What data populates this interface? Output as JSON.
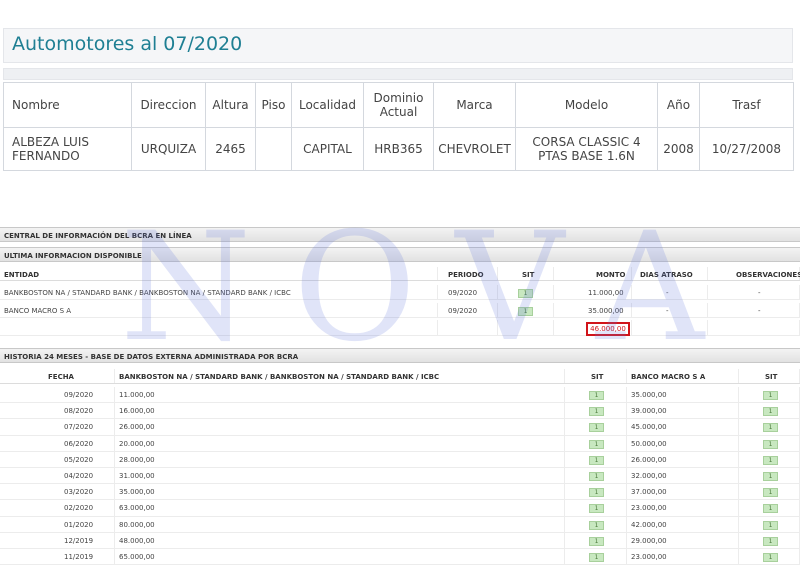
{
  "automotores": {
    "title": "Automotores al 07/2020",
    "columns": [
      "Nombre",
      "Direccion",
      "Altura",
      "Piso",
      "Localidad",
      "Dominio Actual",
      "Marca",
      "Modelo",
      "Año",
      "Trasf"
    ],
    "row": [
      "ALBEZA LUIS FERNANDO",
      "URQUIZA",
      "2465",
      "",
      "CAPITAL",
      "HRB365",
      "CHEVROLET",
      "CORSA CLASSIC 4 PTAS BASE 1.6N",
      "2008",
      "10/27/2008"
    ]
  },
  "bcra": {
    "header": "CENTRAL DE INFORMACIÓN DEL BCRA EN LÍNEA",
    "ultima_title": "ULTIMA INFORMACION DISPONIBLE",
    "ultima_columns": [
      "ENTIDAD",
      "PERIODO",
      "SIT",
      "MONTO",
      "DIAS ATRASO",
      "OBSERVACIONES"
    ],
    "ultima_rows": [
      {
        "entidad": "BANKBOSTON NA / STANDARD BANK / BANKBOSTON NA / STANDARD BANK / ICBC",
        "periodo": "09/2020",
        "sit": "1",
        "monto": "11.000,00",
        "dias": "-",
        "obs": "-"
      },
      {
        "entidad": "BANCO MACRO S A",
        "periodo": "09/2020",
        "sit": "1",
        "monto": "35.000,00",
        "dias": "-",
        "obs": "-"
      }
    ],
    "total": "46.000,00",
    "historia_title": "HISTORIA 24 MESES - BASE DE DATOS EXTERNA ADMINISTRADA POR BCRA",
    "historia_columns": [
      "FECHA",
      "BANKBOSTON NA / STANDARD BANK / BANKBOSTON NA / STANDARD BANK / ICBC",
      "SIT",
      "BANCO MACRO S A",
      "SIT"
    ],
    "historia_rows": [
      {
        "fecha": "09/2020",
        "monto1": "11.000,00",
        "sit1": "1",
        "monto2": "35.000,00",
        "sit2": "1"
      },
      {
        "fecha": "08/2020",
        "monto1": "16.000,00",
        "sit1": "1",
        "monto2": "39.000,00",
        "sit2": "1"
      },
      {
        "fecha": "07/2020",
        "monto1": "26.000,00",
        "sit1": "1",
        "monto2": "45.000,00",
        "sit2": "1"
      },
      {
        "fecha": "06/2020",
        "monto1": "20.000,00",
        "sit1": "1",
        "monto2": "50.000,00",
        "sit2": "1"
      },
      {
        "fecha": "05/2020",
        "monto1": "28.000,00",
        "sit1": "1",
        "monto2": "26.000,00",
        "sit2": "1"
      },
      {
        "fecha": "04/2020",
        "monto1": "31.000,00",
        "sit1": "1",
        "monto2": "32.000,00",
        "sit2": "1"
      },
      {
        "fecha": "03/2020",
        "monto1": "35.000,00",
        "sit1": "1",
        "monto2": "37.000,00",
        "sit2": "1"
      },
      {
        "fecha": "02/2020",
        "monto1": "63.000,00",
        "sit1": "1",
        "monto2": "23.000,00",
        "sit2": "1"
      },
      {
        "fecha": "01/2020",
        "monto1": "80.000,00",
        "sit1": "1",
        "monto2": "42.000,00",
        "sit2": "1"
      },
      {
        "fecha": "12/2019",
        "monto1": "48.000,00",
        "sit1": "1",
        "monto2": "29.000,00",
        "sit2": "1"
      },
      {
        "fecha": "11/2019",
        "monto1": "65.000,00",
        "sit1": "1",
        "monto2": "23.000,00",
        "sit2": "1"
      }
    ]
  },
  "watermark": "NOVA"
}
